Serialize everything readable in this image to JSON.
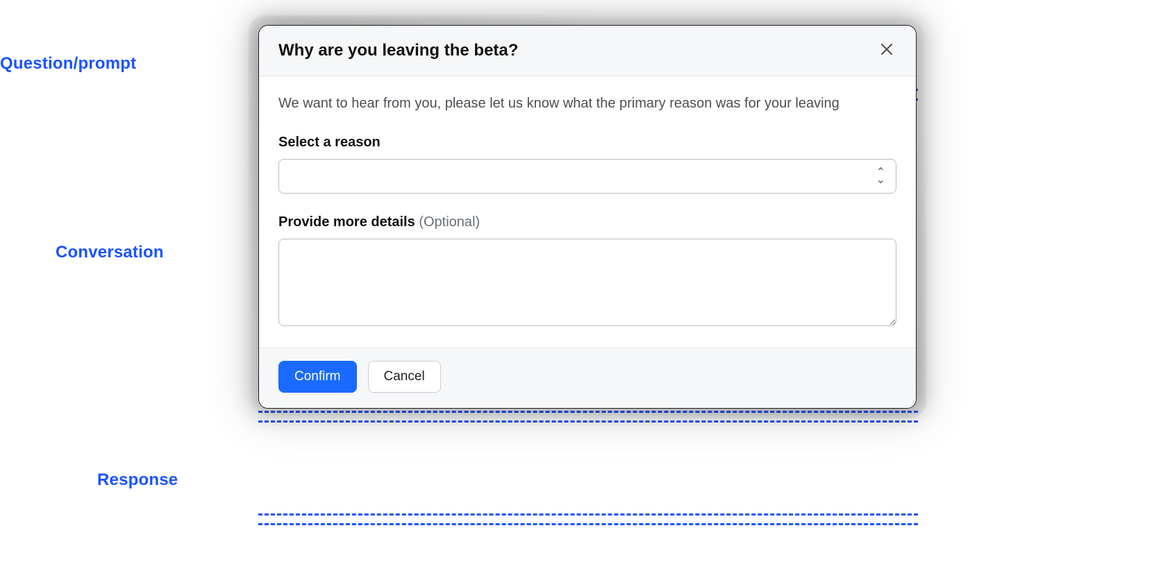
{
  "annotations": {
    "question_prompt": "Question/prompt",
    "conversation": "Conversation",
    "response": "Response"
  },
  "dialog": {
    "title": "Why are you leaving the beta?",
    "intro": "We want to hear from you, please let us know what the primary reason was for your leaving",
    "fields": {
      "reason": {
        "label": "Select a reason",
        "value": ""
      },
      "details": {
        "label_main": "Provide more details",
        "label_optional": "(Optional)",
        "value": ""
      }
    },
    "buttons": {
      "confirm": "Confirm",
      "cancel": "Cancel"
    }
  }
}
